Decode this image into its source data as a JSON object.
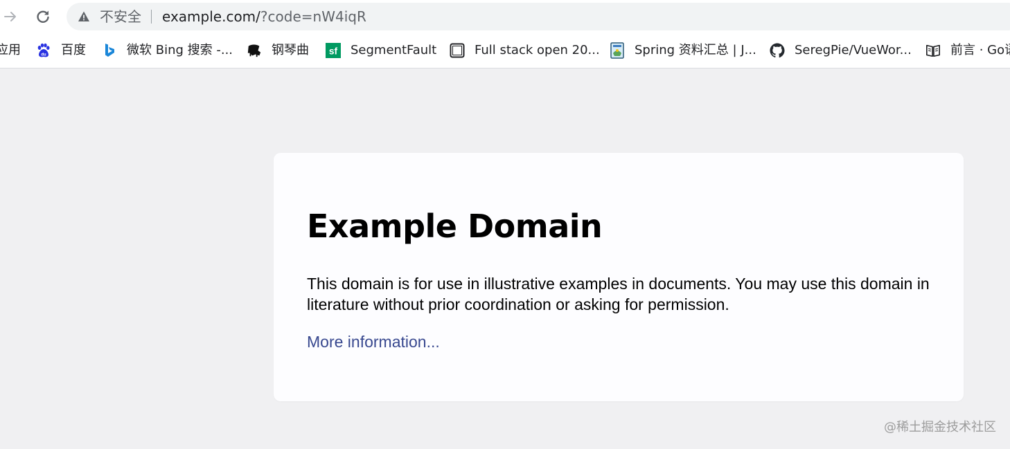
{
  "toolbar": {
    "security_label": "不安全",
    "url_host": "example.com/",
    "url_query": "?code=nW4iqR"
  },
  "bookmarks": [
    {
      "label": "应用",
      "icon": "apps-icon"
    },
    {
      "label": "百度",
      "icon": "baidu-icon"
    },
    {
      "label": "微软 Bing 搜索 -...",
      "icon": "bing-icon"
    },
    {
      "label": "钢琴曲",
      "icon": "piano-icon"
    },
    {
      "label": "SegmentFault",
      "icon": "segmentfault-icon"
    },
    {
      "label": "Full stack open 20...",
      "icon": "page-icon"
    },
    {
      "label": "Spring 资料汇总 | J...",
      "icon": "spring-icon"
    },
    {
      "label": "SeregPie/VueWor...",
      "icon": "github-icon"
    },
    {
      "label": "前言 · Go语",
      "icon": "book-icon"
    }
  ],
  "page": {
    "heading": "Example Domain",
    "body": "This domain is for use in illustrative examples in documents. You may use this domain in literature without prior coordination or asking for permission.",
    "link": "More information..."
  },
  "watermark": "@稀土掘金技术社区",
  "colors": {
    "page_background": "#f0f0f2",
    "card_background": "#fdfdff",
    "link": "#38488f",
    "sf_green": "#009a61",
    "baidu_blue": "#2932e1",
    "bing_blue": "#1a86d8"
  }
}
